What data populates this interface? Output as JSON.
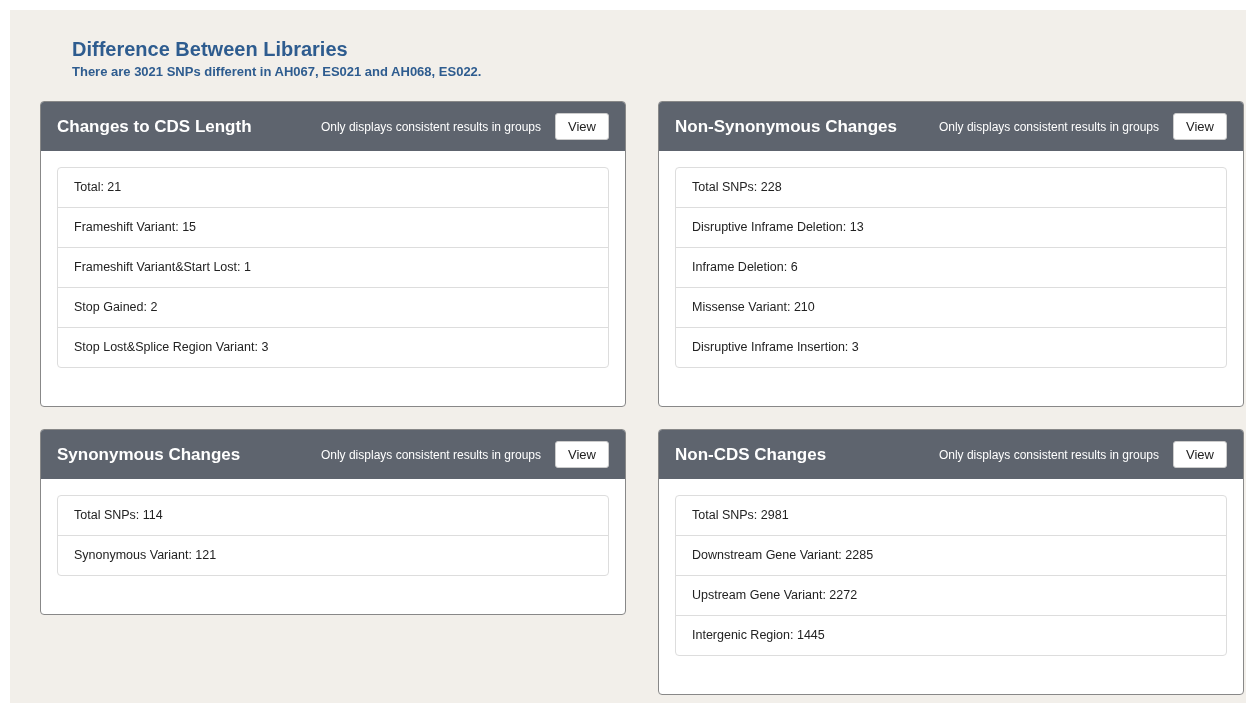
{
  "title": "Difference Between Libraries",
  "subtitle": "There are 3021 SNPs different in AH067, ES021 and AH068, ES022.",
  "panels": [
    {
      "title": "Changes to CDS Length",
      "note": "Only displays consistent results in groups",
      "button": "View",
      "items": [
        "Total: 21",
        "Frameshift Variant: 15",
        "Frameshift Variant&Start Lost: 1",
        "Stop Gained: 2",
        "Stop Lost&Splice Region Variant: 3"
      ]
    },
    {
      "title": "Non-Synonymous Changes",
      "note": "Only displays consistent results in groups",
      "button": "View",
      "items": [
        "Total SNPs: 228",
        "Disruptive Inframe Deletion: 13",
        "Inframe Deletion: 6",
        "Missense Variant: 210",
        "Disruptive Inframe Insertion: 3"
      ]
    },
    {
      "title": "Synonymous Changes",
      "note": "Only displays consistent results in groups",
      "button": "View",
      "items": [
        "Total SNPs: 114",
        "Synonymous Variant: 121"
      ]
    },
    {
      "title": "Non-CDS Changes",
      "note": "Only displays consistent results in groups",
      "button": "View",
      "items": [
        "Total SNPs: 2981",
        "Downstream Gene Variant: 2285",
        "Upstream Gene Variant: 2272",
        "Intergenic Region: 1445"
      ]
    }
  ]
}
